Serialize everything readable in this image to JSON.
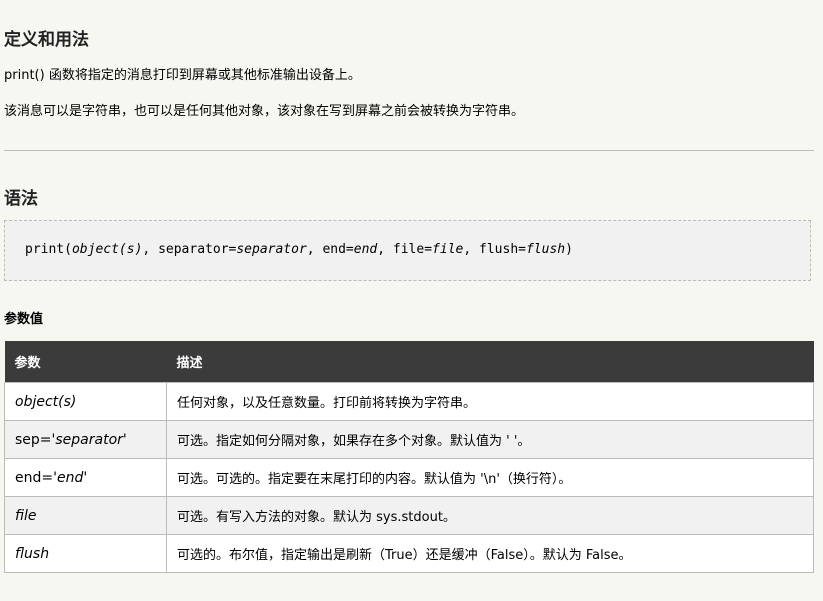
{
  "section1": {
    "heading": "定义和用法",
    "para1": "print() 函数将指定的消息打印到屏幕或其他标准输出设备上。",
    "para2": "该消息可以是字符串，也可以是任何其他对象，该对象在写到屏幕之前会被转换为字符串。"
  },
  "section2": {
    "heading": "语法",
    "code": {
      "p1": "print(",
      "p2": "object(s)",
      "p3": ", separator=",
      "p4": "separator",
      "p5": ", end=",
      "p6": "end",
      "p7": ", file=",
      "p8": "file",
      "p9": ", flush=",
      "p10": "flush",
      "p11": ")"
    }
  },
  "params": {
    "heading": "参数值",
    "col1": "参数",
    "col2": "描述",
    "rows": [
      {
        "pre": "",
        "name": "object(s)",
        "post": "",
        "desc": "任何对象，以及任意数量。打印前将转换为字符串。"
      },
      {
        "pre": "sep='",
        "name": "separator",
        "post": "'",
        "desc": "可选。指定如何分隔对象，如果存在多个对象。默认值为 ' '。"
      },
      {
        "pre": "end='",
        "name": "end",
        "post": "'",
        "desc": "可选。可选的。指定要在末尾打印的内容。默认值为 '\\n'（换行符）。"
      },
      {
        "pre": "",
        "name": "file",
        "post": "",
        "desc": "可选。有写入方法的对象。默认为 sys.stdout。"
      },
      {
        "pre": "",
        "name": "flush",
        "post": "",
        "desc": "可选的。布尔值，指定输出是刷新（True）还是缓冲（False）。默认为 False。"
      }
    ]
  }
}
